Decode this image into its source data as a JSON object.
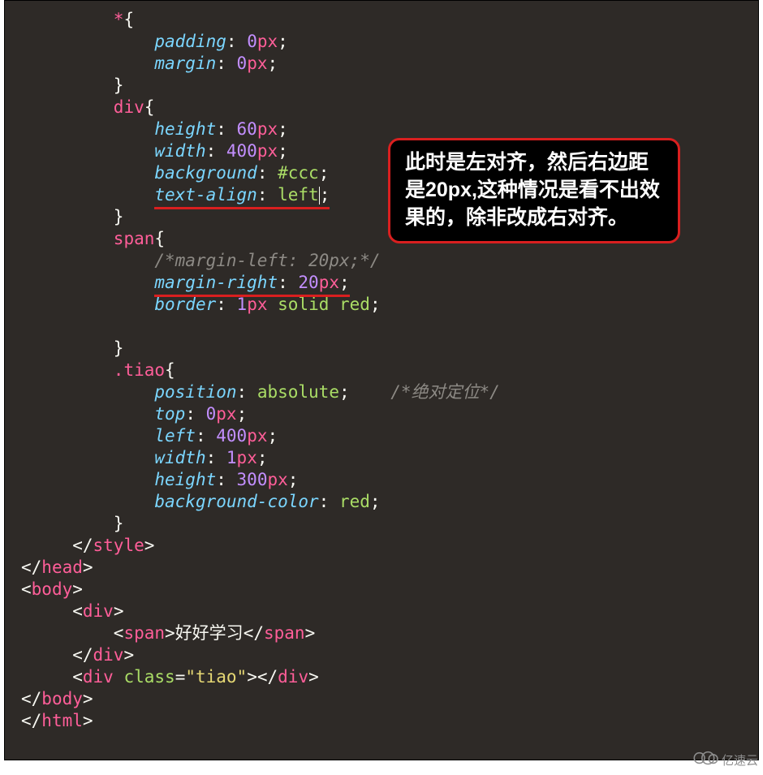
{
  "colors": {
    "selector": "#ff5e99",
    "property_italic_cyan": "#7bd6ff",
    "value_green": "#aadd66",
    "number_purple": "#c38fff",
    "unit_pink": "#ff5e99",
    "comment_gray": "#8d8a85",
    "string_yellow": "#e6d874",
    "plain": "#f8f8f2",
    "background": "#2e2a27",
    "underline": "#d91f1f",
    "box_bg": "#000000",
    "box_border": "#d91f1f",
    "box_text": "#ffffff"
  },
  "annotation": {
    "text": "此时是左对齐，然后右边距是20px,这种情况是看不出效果的，除非改成右对齐。"
  },
  "css_inline_comment": "/*绝对定位*/",
  "watermark": {
    "label": "亿速云"
  },
  "code": {
    "rule_star": {
      "selector": "*",
      "open": "{",
      "close": "}",
      "decl1_prop": "padding",
      "decl1_val_num": "0",
      "decl1_val_unit": "px",
      "decl2_prop": "margin",
      "decl2_val_num": "0",
      "decl2_val_unit": "px"
    },
    "rule_div": {
      "selector": "div",
      "open": "{",
      "close": "}",
      "decl1_prop": "height",
      "decl1_val_num": "60",
      "decl1_val_unit": "px",
      "decl2_prop": "width",
      "decl2_val_num": "400",
      "decl2_val_unit": "px",
      "decl3_prop": "background",
      "decl3_val": "#ccc",
      "decl4_prop": "text-align",
      "decl4_val": "left"
    },
    "rule_span": {
      "selector": "span",
      "open": "{",
      "close": "}",
      "comment": "/*margin-left: 20px;*/",
      "decl1_prop": "margin-right",
      "decl1_val_num": "20",
      "decl1_val_unit": "px",
      "decl2_prop": "border",
      "decl2_val_num": "1",
      "decl2_val_unit": "px",
      "decl2_val_kw1": "solid",
      "decl2_val_kw2": "red"
    },
    "rule_tiao": {
      "selector": ".tiao",
      "open": "{",
      "close": "}",
      "decl1_prop": "position",
      "decl1_val": "absolute",
      "decl2_prop": "top",
      "decl2_val_num": "0",
      "decl2_val_unit": "px",
      "decl3_prop": "left",
      "decl3_val_num": "400",
      "decl3_val_unit": "px",
      "decl4_prop": "width",
      "decl4_val_num": "1",
      "decl4_val_unit": "px",
      "decl5_prop": "height",
      "decl5_val_num": "300",
      "decl5_val_unit": "px",
      "decl6_prop": "background-color",
      "decl6_val": "red"
    },
    "close_style_open": "</",
    "close_style_tag": "style",
    "close_style_end": ">",
    "close_head_open": "</",
    "close_head_tag": "head",
    "close_head_end": ">",
    "open_body_open": "<",
    "open_body_tag": "body",
    "open_body_end": ">",
    "open_div_open": "<",
    "open_div_tag": "div",
    "open_div_end": ">",
    "open_span_open": "<",
    "open_span_tag": "span",
    "open_span_end": ">",
    "span_text": "好好学习",
    "close_span_open": "</",
    "close_span_tag": "span",
    "close_span_end": ">",
    "close_div_open": "</",
    "close_div_tag": "div",
    "close_div_end": ">",
    "div2_open": "<",
    "div2_tag": "div",
    "div2_attr_name": "class",
    "div2_eq": "=",
    "div2_attr_val": "\"tiao\"",
    "div2_end": ">",
    "div2_close_open": "</",
    "div2_close_tag": "div",
    "div2_close_end": ">",
    "close_body_open": "</",
    "close_body_tag": "body",
    "close_body_end": ">",
    "close_html_open": "</",
    "close_html_tag": "html",
    "close_html_end": ">"
  }
}
